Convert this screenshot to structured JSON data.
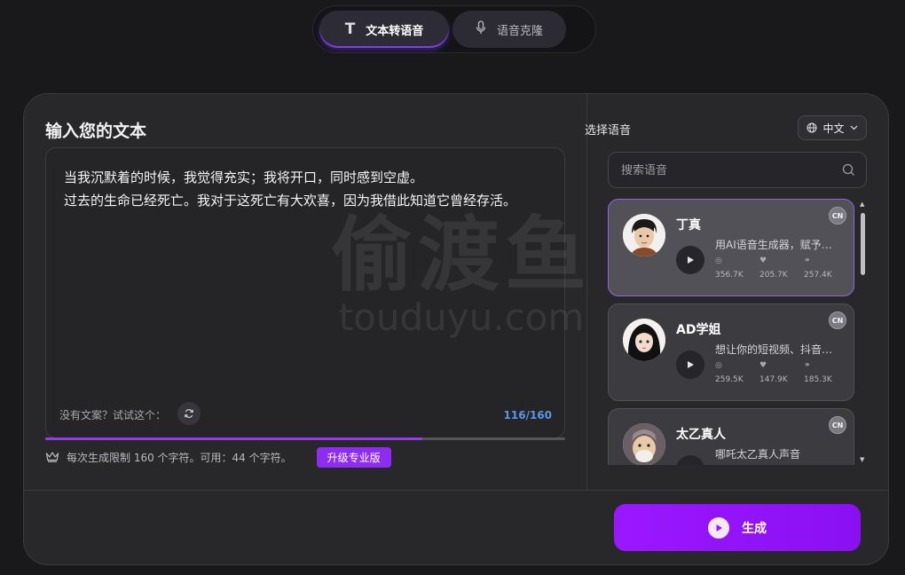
{
  "mode_tabs": [
    {
      "label": "文本转语音",
      "icon": "text-icon",
      "active": true
    },
    {
      "label": "语音克隆",
      "icon": "microphone-icon",
      "active": false
    }
  ],
  "input_panel": {
    "title": "输入您的文本",
    "text": "当我沉默着的时候，我觉得充实；我将开口，同时感到空虚。\n过去的生命已经死亡。我对于这死亡有大欢喜，因为我借此知道它曾经存活。",
    "hint": "没有文案？试试这个：",
    "char_count": "116/160",
    "usage_fraction": 0.725,
    "limit_text": "每次生成限制 160 个字符。可用：44 个字符。",
    "upgrade_label": "升级专业版"
  },
  "voice_panel": {
    "label": "选择语音",
    "language": "中文",
    "search_placeholder": "搜索语音",
    "voices": [
      {
        "name": "丁真",
        "badge": "CN",
        "desc": "用AI语音生成器，赋予你…",
        "stats": [
          "356.7K",
          "205.7K",
          "257.4K"
        ],
        "selected": true
      },
      {
        "name": "AD学姐",
        "badge": "CN",
        "desc": "想让你的短视频、抖音内…",
        "stats": [
          "259.5K",
          "147.9K",
          "185.3K"
        ],
        "selected": false
      },
      {
        "name": "太乙真人",
        "badge": "CN",
        "desc": "哪吒太乙真人声音",
        "stats": [
          "",
          "",
          ""
        ],
        "selected": false
      }
    ]
  },
  "generate_label": "生成",
  "watermark": {
    "main": "偷渡鱼",
    "sub": "touduyu.com"
  },
  "colors": {
    "accent": "#9b17ff",
    "counter": "#5c95e8",
    "selected_border": "#8f67e6"
  }
}
